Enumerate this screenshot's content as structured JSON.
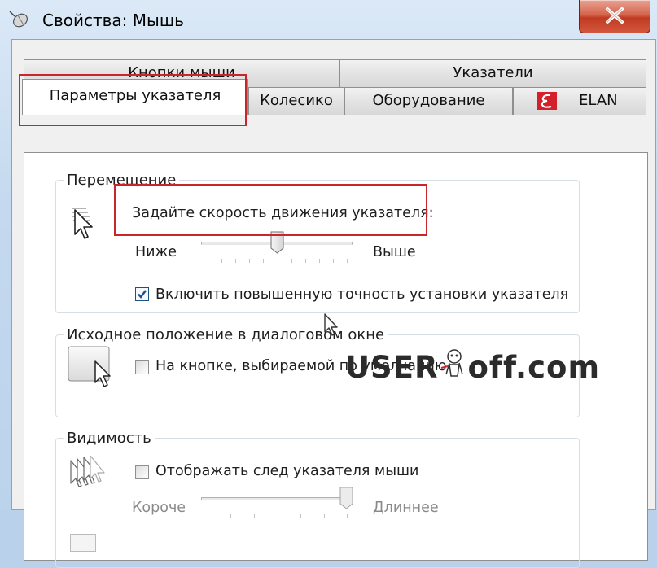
{
  "window": {
    "title": "Свойства: Мышь"
  },
  "tabs": {
    "row_back": [
      {
        "label": "Кнопки мыши"
      },
      {
        "label": "Указатели"
      }
    ],
    "row_front": [
      {
        "label": "Параметры указателя",
        "active": true
      },
      {
        "label": "Колесико"
      },
      {
        "label": "Оборудование"
      },
      {
        "label": "ELAN"
      }
    ]
  },
  "motion": {
    "group_title": "Перемещение",
    "prompt": "Задайте скорость движения указателя:",
    "slow_label": "Ниже",
    "fast_label": "Выше",
    "speed_fraction": 0.5,
    "precision_label": "Включить повышенную точность установки указателя",
    "precision_checked": true
  },
  "snap_to": {
    "group_title": "Исходное положение в диалоговом окне",
    "checkbox_label": "На кнопке, выбираемой по умолчанию",
    "checked": false
  },
  "visibility": {
    "group_title": "Видимость",
    "trails_label": "Отображать след указателя мыши",
    "trails_checked": false,
    "short_label": "Короче",
    "long_label": "Длиннее",
    "trails_fraction": 1.0
  },
  "watermark": {
    "text_a": "USER",
    "text_b": "off.com"
  },
  "colors": {
    "highlight": "#c8252c",
    "elan_logo": "#d4202a"
  },
  "icons": {
    "title": "mouse-icon",
    "close": "close-icon",
    "elan": "elan-logo-icon",
    "motion": "pointer-speed-icon",
    "snap": "snap-to-button-icon",
    "trails": "pointer-trails-icon"
  }
}
